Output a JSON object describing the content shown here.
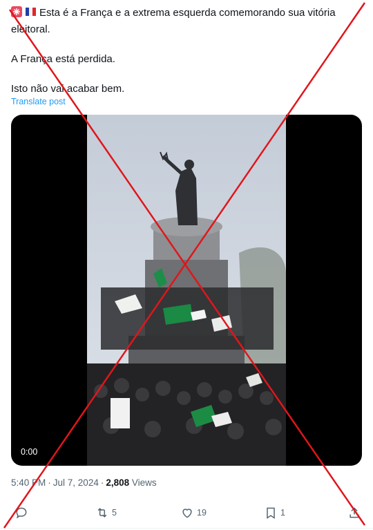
{
  "tweet": {
    "line1": "Esta é a França e a extrema esquerda comemorando sua vitória eleitoral.",
    "line2": "A França está perdida.",
    "line3": "Isto não vai acabar bem.",
    "translate_label": "Translate post"
  },
  "media": {
    "duration": "0:00"
  },
  "meta": {
    "time": "5:40 PM",
    "separator": "·",
    "date": "Jul 7, 2024",
    "views_count": "2,808",
    "views_label": "Views"
  },
  "actions": {
    "reply_count": "",
    "repost_count": "5",
    "like_count": "19",
    "bookmark_count": "1"
  },
  "icons": [
    "reply-icon",
    "repost-icon",
    "like-icon",
    "bookmark-icon",
    "share-icon"
  ],
  "colors": {
    "cross": "#e0161b",
    "link": "#1d9bf0",
    "muted": "#536471"
  }
}
